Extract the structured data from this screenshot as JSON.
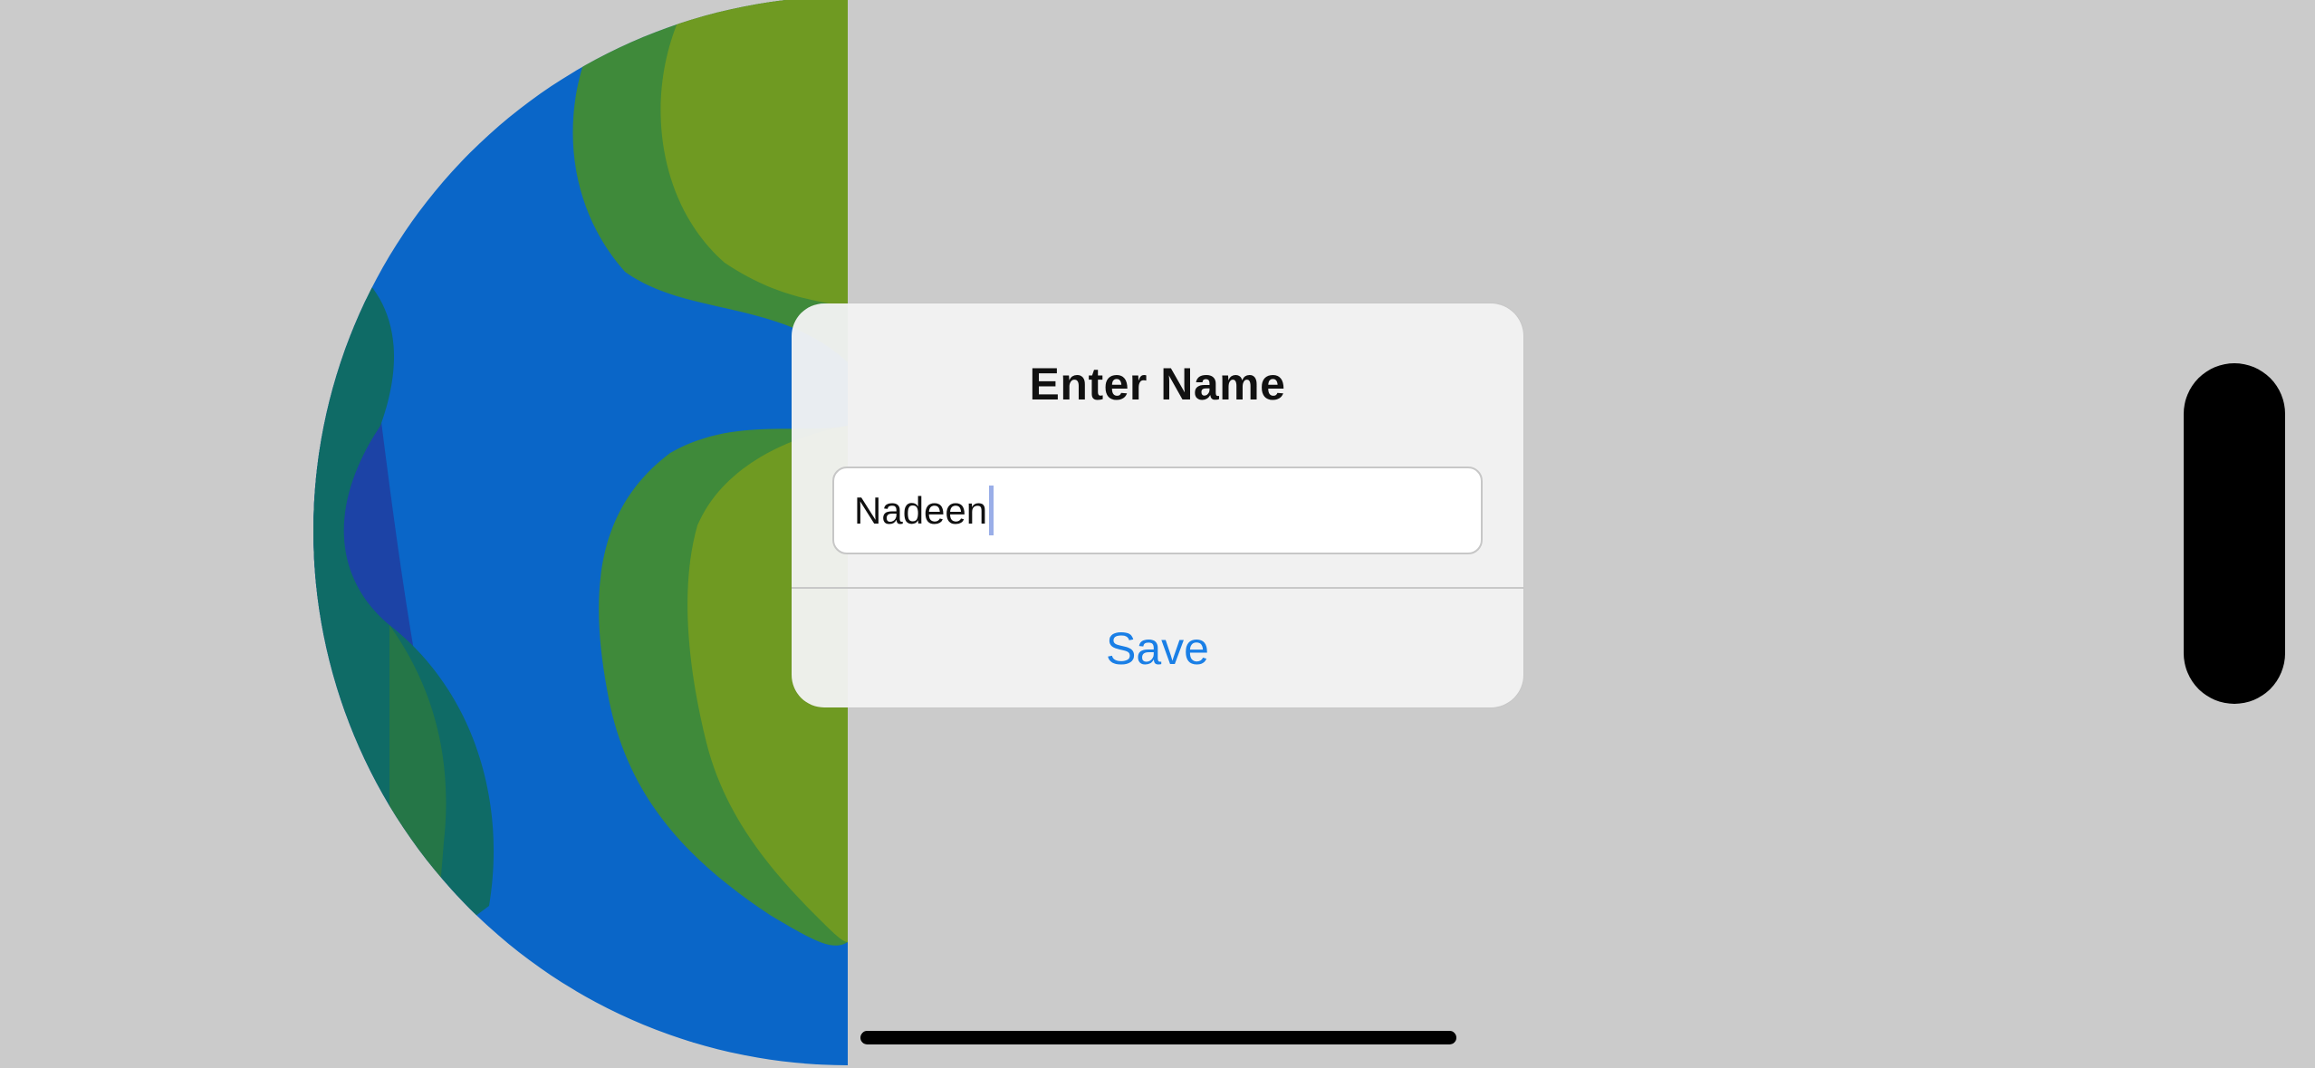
{
  "dialog": {
    "title": "Enter Name",
    "name_field_value": "Nadeen",
    "save_label": "Save"
  },
  "illustration": {
    "name": "globe",
    "colors": {
      "ocean": "#0a66c8",
      "ocean_dark": "#1c43a6",
      "land_green": "#3f8a3a",
      "land_olive": "#6f9a22",
      "land_teal": "#0f6b66"
    }
  },
  "colors": {
    "background": "#cbcbcb",
    "accent": "#1a7fe6"
  }
}
